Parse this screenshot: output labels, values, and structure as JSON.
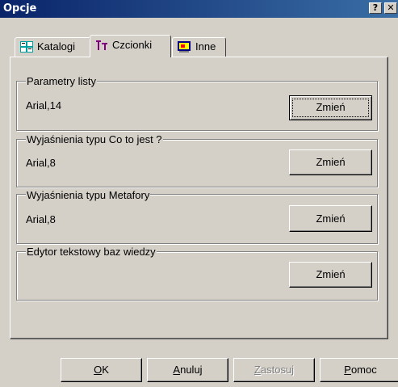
{
  "window": {
    "title": "Opcje",
    "help_glyph": "?",
    "close_glyph": "✕"
  },
  "tabs": [
    {
      "label": "Katalogi",
      "icon": "catalog-icon",
      "active": false
    },
    {
      "label": "Czcionki",
      "icon": "font-icon",
      "active": true
    },
    {
      "label": "Inne",
      "icon": "image-icon",
      "active": false
    }
  ],
  "groups": [
    {
      "title": "Parametry listy",
      "value": "Arial,14",
      "button": "Zmień",
      "focused": true
    },
    {
      "title": "Wyjaśnienia typu Co to jest ?",
      "value": "Arial,8",
      "button": "Zmień",
      "focused": false
    },
    {
      "title": "Wyjaśnienia typu Metafory",
      "value": "Arial,8",
      "button": "Zmień",
      "focused": false
    },
    {
      "title": "Edytor tekstowy baz wiedzy",
      "value": "",
      "button": "Zmień",
      "focused": false
    }
  ],
  "footer": {
    "ok_first": "O",
    "ok_rest": "K",
    "cancel_first": "A",
    "cancel_rest": "nuluj",
    "apply_first": "Z",
    "apply_rest": "astosuj",
    "help_first": "P",
    "help_rest": "omoc"
  },
  "colors": {
    "titlebar_start": "#0a246a",
    "titlebar_end": "#3a6ea5",
    "face": "#d4d0c8"
  }
}
